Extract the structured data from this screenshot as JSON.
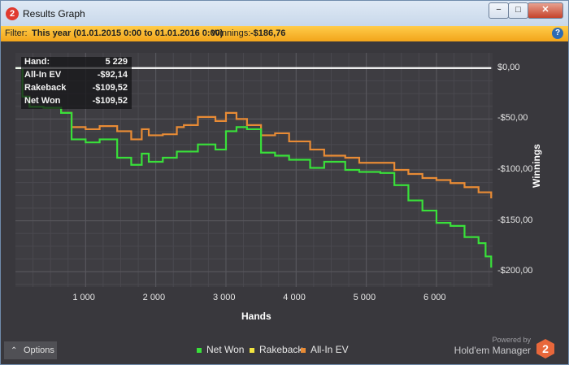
{
  "window": {
    "app_icon_text": "2",
    "title": "Results Graph",
    "minimize_glyph": "−",
    "maximize_glyph": "□",
    "close_glyph": "✕"
  },
  "filter": {
    "label": "Filter:",
    "value": "This year (01.01.2015 0:00 to 01.01.2016 0:00)",
    "winnings_label": "Winnings:",
    "winnings_value": "-$186,76",
    "help_glyph": "?"
  },
  "tooltip": {
    "rows": [
      {
        "label": "Hand:",
        "value": "5 229"
      },
      {
        "label": "All-In EV",
        "value": "-$92,14"
      },
      {
        "label": "Rakeback",
        "value": "-$109,52"
      },
      {
        "label": "Net Won",
        "value": "-$109,52"
      }
    ]
  },
  "colors": {
    "net_won": "#39e03a",
    "rakeback": "#f2e440",
    "all_in_ev": "#e88b35",
    "zero_line": "#ffffff"
  },
  "chart_data": {
    "type": "line",
    "xlabel": "Hands",
    "ylabel": "Winnings",
    "xlim": [
      0,
      6800
    ],
    "ylim": [
      -215,
      15
    ],
    "xticks": [
      1000,
      2000,
      3000,
      4000,
      5000,
      6000
    ],
    "xtick_labels": [
      "1 000",
      "2 000",
      "3 000",
      "4 000",
      "5 000",
      "6 000"
    ],
    "yticks": [
      0,
      -50,
      -100,
      -150,
      -200
    ],
    "ytick_labels": [
      "$0,00",
      "-$50,00",
      "-$100,00",
      "-$150,00",
      "-$200,00"
    ],
    "grid": true,
    "legend_position": "bottom-center",
    "series": [
      {
        "name": "Net Won",
        "color": "#39e03a",
        "x": [
          0,
          100,
          200,
          400,
          650,
          800,
          1000,
          1200,
          1450,
          1650,
          1800,
          1900,
          2100,
          2300,
          2400,
          2600,
          2850,
          3000,
          3150,
          3300,
          3500,
          3700,
          3900,
          4200,
          4400,
          4700,
          4900,
          5200,
          5400,
          5600,
          5800,
          6000,
          6200,
          6400,
          6600,
          6700,
          6780
        ],
        "y": [
          0,
          -28,
          -38,
          -39,
          -44,
          -70,
          -73,
          -70,
          -88,
          -95,
          -84,
          -92,
          -88,
          -82,
          -82,
          -75,
          -80,
          -62,
          -58,
          -60,
          -83,
          -86,
          -90,
          -98,
          -92,
          -100,
          -102,
          -103,
          -115,
          -130,
          -140,
          -152,
          -155,
          -166,
          -172,
          -185,
          -196
        ]
      },
      {
        "name": "Rakeback",
        "color": "#f2e440",
        "x": [
          0,
          6780
        ],
        "y": [
          0,
          0
        ]
      },
      {
        "name": "All-In EV",
        "color": "#e88b35",
        "x": [
          0,
          100,
          200,
          400,
          650,
          800,
          1000,
          1200,
          1450,
          1650,
          1800,
          1900,
          2100,
          2300,
          2400,
          2600,
          2850,
          3000,
          3150,
          3300,
          3500,
          3700,
          3900,
          4200,
          4400,
          4700,
          4900,
          5200,
          5400,
          5600,
          5800,
          6000,
          6200,
          6400,
          6600,
          6700,
          6780
        ],
        "y": [
          0,
          -28,
          -38,
          -39,
          -44,
          -58,
          -60,
          -57,
          -62,
          -70,
          -60,
          -66,
          -65,
          -58,
          -56,
          -48,
          -52,
          -44,
          -50,
          -56,
          -66,
          -64,
          -72,
          -80,
          -86,
          -88,
          -93,
          -93,
          -100,
          -104,
          -108,
          -110,
          -113,
          -117,
          -122,
          -122,
          -128
        ]
      }
    ]
  },
  "legend": {
    "items": [
      "Net Won",
      "Rakeback",
      "All-In EV"
    ]
  },
  "footer": {
    "options_label": "Options",
    "options_glyph": "⌃",
    "powered_by": "Powered by",
    "brand": "Hold'em Manager",
    "logo_text": "2"
  }
}
